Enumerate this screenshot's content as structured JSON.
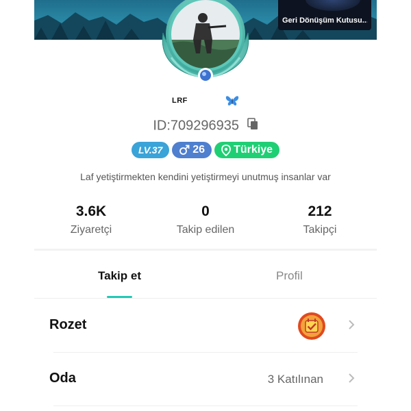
{
  "banner": {
    "mini_video_title": "Geri Dönüşüm Kutusu..."
  },
  "profile": {
    "name": "LRF",
    "id_text": "ID:709296935",
    "level": "LV.37",
    "age": "26",
    "location": "Türkiye",
    "bio": "Laf yetiştirmekten kendini yetiştirmeyi unutmuş insanlar var"
  },
  "stats": [
    {
      "value": "3.6K",
      "label": "Ziyaretçi"
    },
    {
      "value": "0",
      "label": "Takip edilen"
    },
    {
      "value": "212",
      "label": "Takipçi"
    }
  ],
  "tabs": [
    {
      "label": "Takip et",
      "active": true
    },
    {
      "label": "Profil",
      "active": false
    }
  ],
  "rows": {
    "badge_label": "Rozet",
    "room_label": "Oda",
    "room_value": "3 Katılınan"
  },
  "colors": {
    "accent": "#23c9b4",
    "level_badge": "#3aa3d8",
    "age_badge": "#4f7fcf",
    "location_badge": "#1fcf74"
  },
  "icons": [
    "copy-icon",
    "male-icon",
    "location-pin-icon",
    "butterfly-icon",
    "medal-icon",
    "chevron-right-icon"
  ]
}
